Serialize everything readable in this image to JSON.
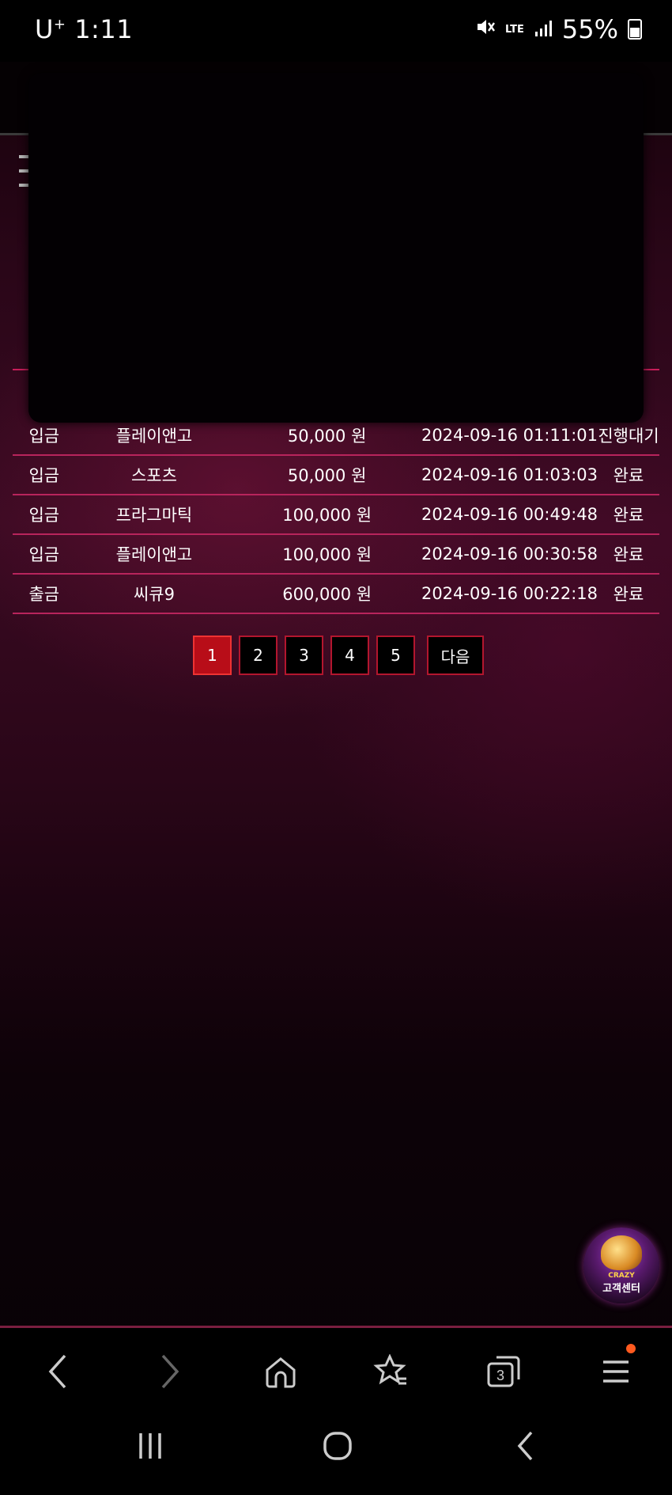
{
  "status_bar": {
    "carrier": "U",
    "carrier_sup": "+",
    "time": "1:11",
    "network": "LTE",
    "battery": "55%"
  },
  "transactions": [
    {
      "type": "입금",
      "game": "플레이앤고",
      "amount": "50,000 원",
      "datetime": "2024-09-16 01:11:01",
      "status": "진행대기"
    },
    {
      "type": "입금",
      "game": "스포츠",
      "amount": "50,000 원",
      "datetime": "2024-09-16 01:03:03",
      "status": "완료"
    },
    {
      "type": "입금",
      "game": "프라그마틱",
      "amount": "100,000 원",
      "datetime": "2024-09-16 00:49:48",
      "status": "완료"
    },
    {
      "type": "입금",
      "game": "플레이앤고",
      "amount": "100,000 원",
      "datetime": "2024-09-16 00:30:58",
      "status": "완료"
    },
    {
      "type": "출금",
      "game": "씨큐9",
      "amount": "600,000 원",
      "datetime": "2024-09-16 00:22:18",
      "status": "완료"
    }
  ],
  "pagination": {
    "pages": [
      "1",
      "2",
      "3",
      "4",
      "5"
    ],
    "current": "1",
    "next_label": "다음"
  },
  "customer_center": {
    "brand": "CRAZY",
    "label": "고객센터"
  },
  "browser_nav": {
    "tabs_count": "3"
  },
  "colors": {
    "accent": "#b80d18",
    "row_border": "#b8245c",
    "badge": "#ff5a1f"
  },
  "icons": [
    "back-icon",
    "forward-icon",
    "home-icon",
    "bookmark-star-icon",
    "tabs-icon",
    "menu-icon",
    "recent-apps-icon",
    "home-circle-icon",
    "system-back-icon",
    "mute-icon",
    "signal-icon",
    "battery-icon"
  ]
}
